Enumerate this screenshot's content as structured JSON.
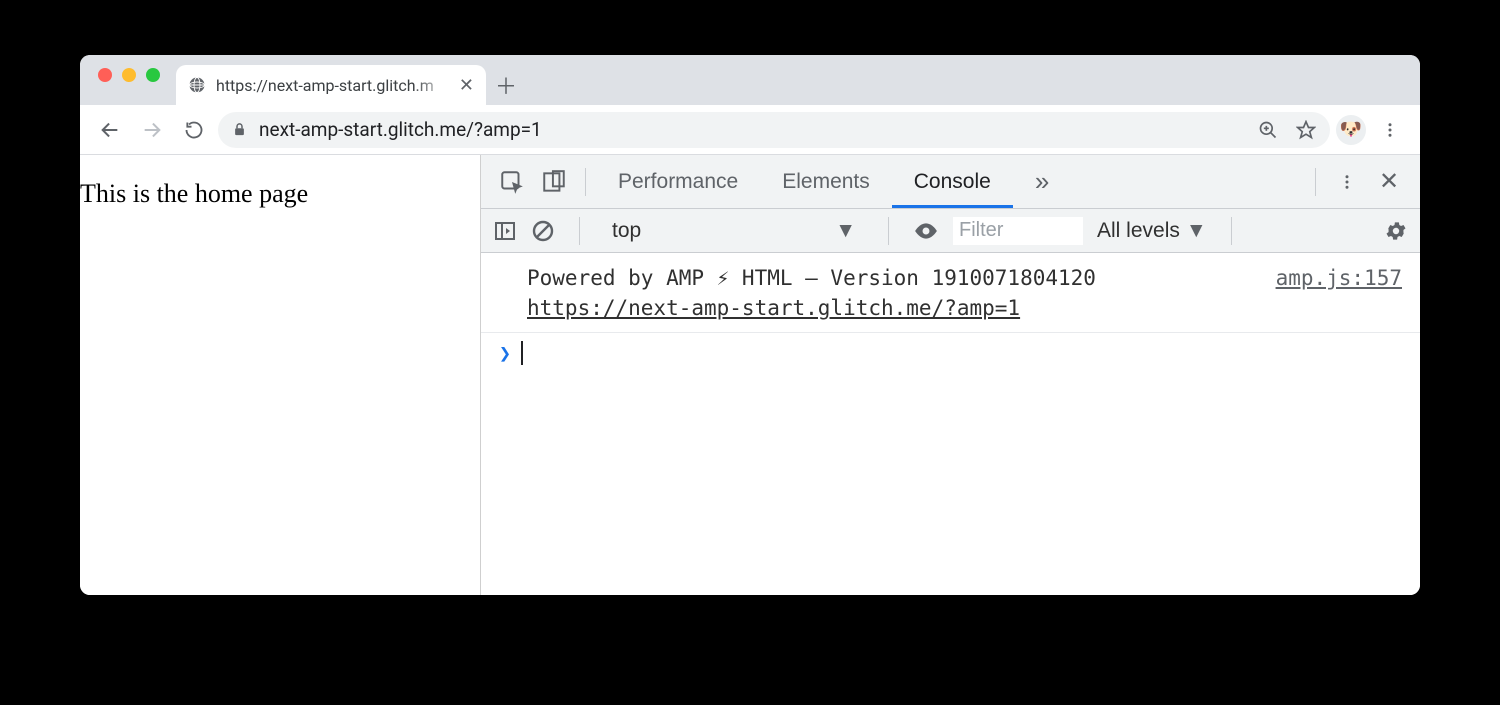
{
  "browser": {
    "tab_title": "https://next-amp-start.glitch.m",
    "url": "next-amp-start.glitch.me/?amp=1"
  },
  "page": {
    "body_text": "This is the home page"
  },
  "devtools": {
    "tabs": {
      "performance": "Performance",
      "elements": "Elements",
      "console": "Console"
    },
    "console_toolbar": {
      "context": "top",
      "filter_placeholder": "Filter",
      "levels_label": "All levels"
    },
    "console_log": {
      "message_line1": "Powered by AMP ⚡ HTML – Version 1910071804120",
      "message_line2_url": "https://next-amp-start.glitch.me/?amp=1",
      "source": "amp.js:157"
    }
  }
}
